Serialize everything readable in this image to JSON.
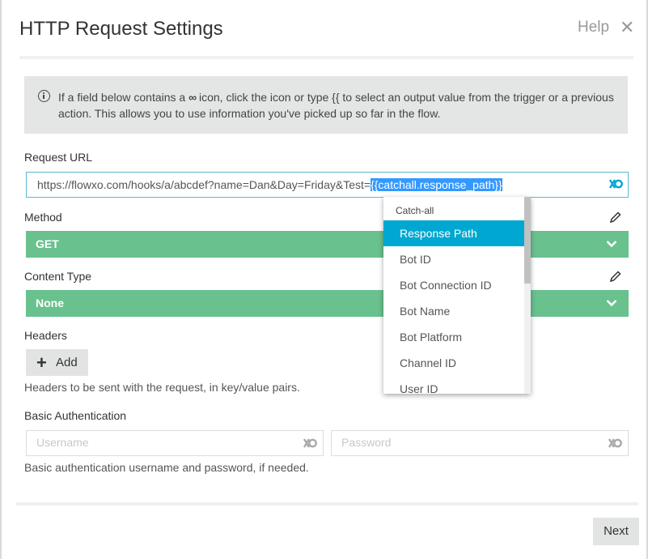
{
  "dialog": {
    "title": "HTTP Request Settings",
    "help_label": "Help",
    "close_glyph": "✕"
  },
  "info": {
    "text_before": "If a field below contains a",
    "loop_glyph": "∞",
    "text_after": "icon, click the icon or type {{ to select an output value from the trigger or a previous action. This allows you to use information you've picked up so far in the flow."
  },
  "request_url": {
    "label": "Request URL",
    "value_plain": "https://flowxo.com/hooks/a/abcdef?name=Dan&Day=Friday&Test=",
    "value_selected": "{{catchall.response_path}}"
  },
  "method": {
    "label": "Method",
    "value": "GET"
  },
  "content_type": {
    "label": "Content Type",
    "value": "None"
  },
  "headers": {
    "label": "Headers",
    "add_label": "Add",
    "add_glyph": "+",
    "hint": "Headers to be sent with the request, in key/value pairs."
  },
  "basic_auth": {
    "label": "Basic Authentication",
    "username_placeholder": "Username",
    "password_placeholder": "Password",
    "hint": "Basic authentication username and password, if needed."
  },
  "dropdown": {
    "header": "Catch-all",
    "items": [
      "Response Path",
      "Bot ID",
      "Bot Connection ID",
      "Bot Name",
      "Bot Platform",
      "Channel ID",
      "User ID"
    ],
    "active_index": 0
  },
  "footer": {
    "next_label": "Next"
  },
  "colors": {
    "accent_green": "#69c18e",
    "accent_blue": "#00a8d1",
    "selection_blue": "#3399ff",
    "focus_border": "#5bb8d6"
  },
  "icons": {
    "info": "info-circle-icon",
    "loop": "infinity-loop-icon",
    "edit": "pencil-icon",
    "chevron": "chevron-down-icon",
    "close": "close-icon",
    "add": "plus-icon"
  }
}
